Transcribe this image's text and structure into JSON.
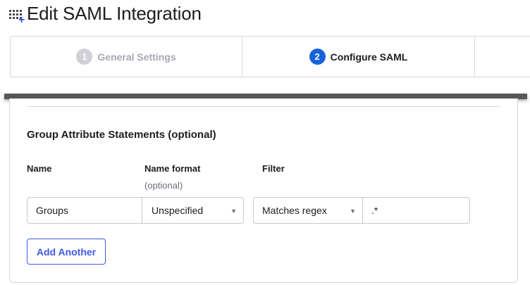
{
  "header": {
    "title": "Edit SAML Integration",
    "icon": "add-app-grid-icon"
  },
  "stepper": {
    "steps": [
      {
        "number": "1",
        "label": "General Settings",
        "state": "completed"
      },
      {
        "number": "2",
        "label": "Configure SAML",
        "state": "active"
      }
    ]
  },
  "group_attributes": {
    "title": "Group Attribute Statements (optional)",
    "columns": {
      "name": "Name",
      "name_format": "Name format",
      "name_format_hint": "(optional)",
      "filter": "Filter"
    },
    "row": {
      "name_value": "Groups",
      "name_format_value": "Unspecified",
      "filter_type": "Matches regex",
      "filter_value": ".*"
    },
    "add_button": "Add Another"
  },
  "colors": {
    "accent": "#3f59e4",
    "active_step": "#1662dd",
    "inactive_step": "#d0d0d6"
  }
}
